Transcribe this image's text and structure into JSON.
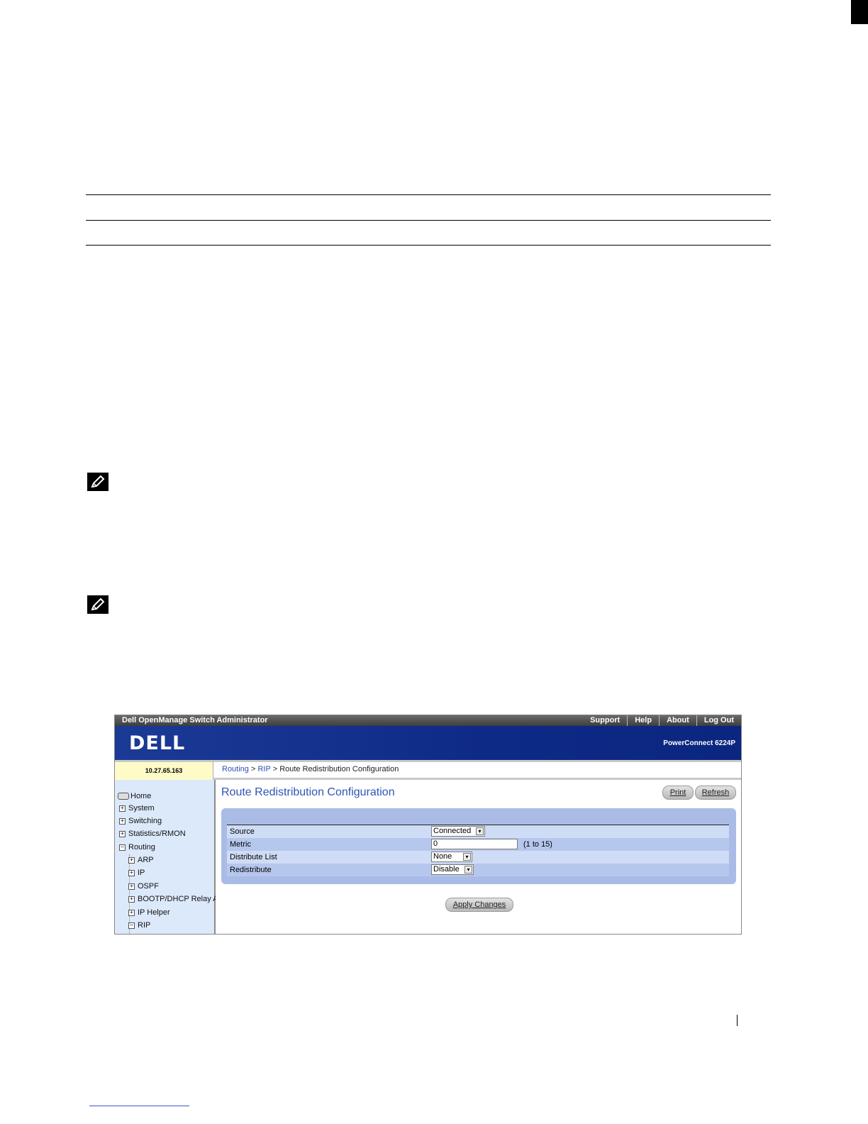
{
  "app": {
    "title": "Dell OpenManage Switch Administrator",
    "top_links": [
      "Support",
      "Help",
      "About",
      "Log Out"
    ],
    "logo": "DELL",
    "model": "PowerConnect 6224P",
    "ip_address": "10.27.65.163"
  },
  "breadcrumb": {
    "items": [
      "Routing",
      "RIP"
    ],
    "separator": ">",
    "current": "Route Redistribution Configuration"
  },
  "sidebar": {
    "items": [
      "Home",
      "System",
      "Switching",
      "Statistics/RMON",
      "Routing",
      "ARP",
      "IP",
      "OSPF",
      "BOOTP/DHCP Relay A",
      "IP Helper",
      "RIP"
    ]
  },
  "page": {
    "title": "Route Redistribution Configuration",
    "print_label": "Print",
    "refresh_label": "Refresh",
    "apply_label": "Apply Changes"
  },
  "form": {
    "source": {
      "label": "Source",
      "value": "Connected"
    },
    "metric": {
      "label": "Metric",
      "value": "0",
      "hint": "(1 to 15)"
    },
    "distribute_list": {
      "label": "Distribute List",
      "value": "None"
    },
    "redistribute": {
      "label": "Redistribute",
      "value": "Disable"
    }
  },
  "colors": {
    "brand": "#0d2a86",
    "panel": "#aabbe6",
    "link": "#2f4fb5"
  }
}
